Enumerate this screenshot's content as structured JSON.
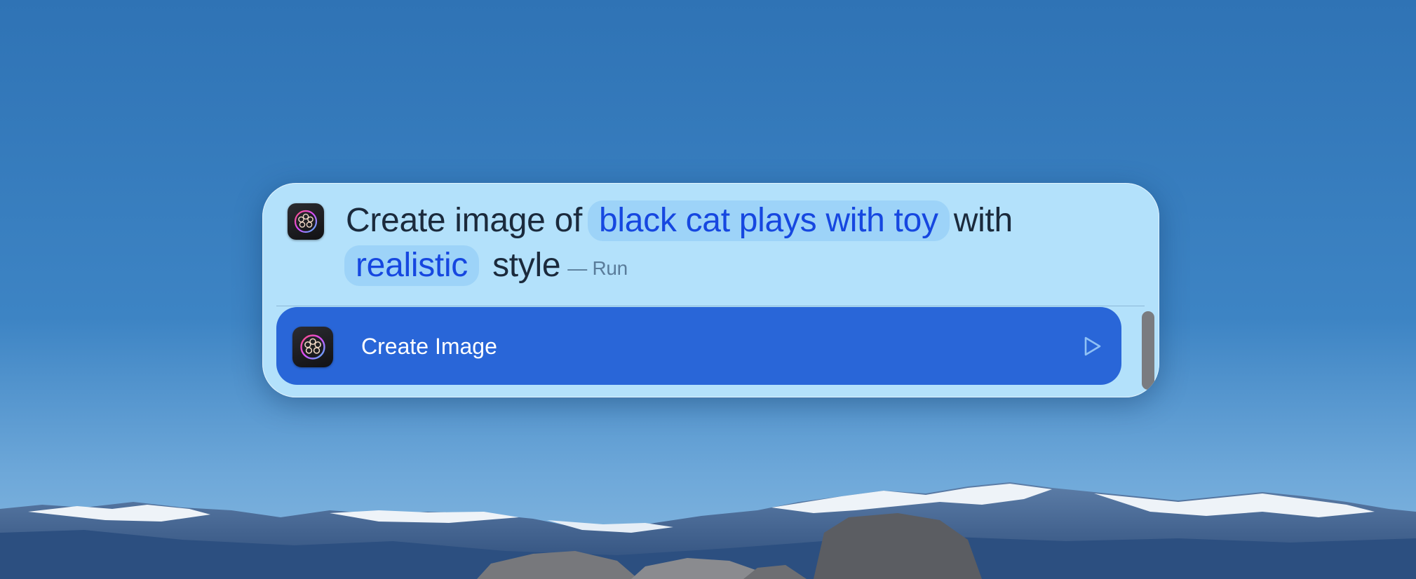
{
  "spotlight": {
    "query": {
      "prefix": "Create image of",
      "subject": "black cat plays with toy",
      "middle": "with",
      "style_value": "realistic",
      "suffix": "style",
      "hint": "— Run"
    },
    "app_icon": "image-playground-icon",
    "results": [
      {
        "label": "Create Image",
        "icon": "image-playground-icon",
        "action_icon": "play-icon",
        "selected": true
      }
    ]
  },
  "colors": {
    "panel": "#b3e1fb",
    "selection": "#2966d8",
    "token_text": "#1647e0",
    "query_text": "#1b2a3c"
  }
}
